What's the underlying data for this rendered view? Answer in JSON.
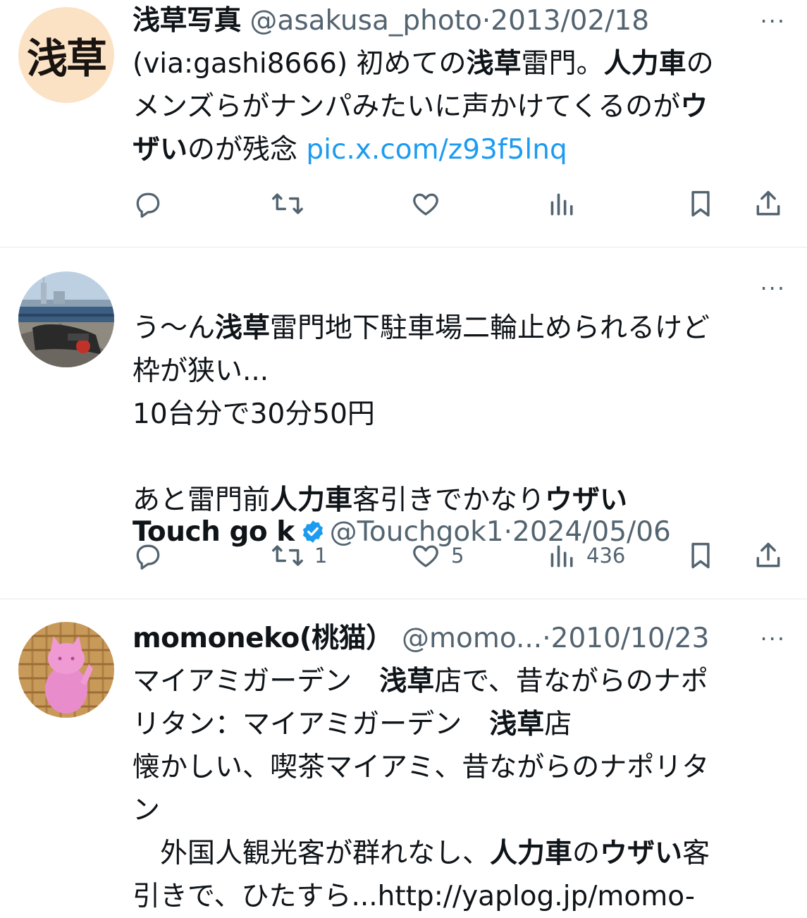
{
  "tweets": [
    {
      "name": "浅草写真",
      "handle": "@asakusa_photo",
      "sep": "·",
      "date": "2013/02/18",
      "avatar_text": "浅草",
      "verified": false,
      "text": {
        "l1a": "(via:gashi8666) 初めての",
        "l1b": "浅草",
        "l1c": "雷門。",
        "l1d": "人力車",
        "l1e": "の",
        "l2a": "メンズらがナンパみたいに声かけてくるのが",
        "l2b": "ウ",
        "l3a": "ザい",
        "l3b": "のが残念 ",
        "link": "pic.x.com/z93f5lnq"
      },
      "stats": {
        "retweets": "",
        "likes": "",
        "views": ""
      }
    },
    {
      "name": "Touch go k",
      "handle": "@Touchgok1",
      "sep": "·",
      "date": "2024/05/06",
      "verified": true,
      "text": {
        "l1a": "う〜ん",
        "l1b": "浅草",
        "l1c": "雷門地下駐車場二輪止められるけど",
        "l2": "枠が狭い...",
        "l3": "10台分で30分50円",
        "l5a": "あと雷門前",
        "l5b": "人力車",
        "l5c": "客引きでかなり",
        "l5d": "ウザい"
      },
      "stats": {
        "retweets": "1",
        "likes": "5",
        "views": "436"
      }
    },
    {
      "name": "momoneko(桃猫）",
      "handle": "@momo...",
      "sep": "·",
      "date": "2010/10/23",
      "verified": false,
      "text": {
        "l1a": "マイアミガーデン　",
        "l1b": "浅草",
        "l1c": "店で、昔ながらのナポ",
        "l2a": "リタン：マイアミガーデン　",
        "l2b": "浅草",
        "l2c": "店",
        "l3": "懐かしい、喫茶マイアミ、昔ながらのナポリタ",
        "l4": "ン",
        "l5a": "　外国人観光客が群れなし、",
        "l5b": "人力車",
        "l5c": "の",
        "l5d": "ウザい",
        "l5e": "客",
        "l6": "引きで、ひたすら...http://yaplog.jp/momo-"
      }
    }
  ],
  "more_label": "···",
  "colors": {
    "link": "#1d9bf0",
    "secondary": "#536471",
    "verified": "#1d9bf0",
    "divider": "#e6e9ec"
  },
  "icons": [
    "reply-icon",
    "retweet-icon",
    "like-icon",
    "views-icon",
    "bookmark-icon",
    "share-icon",
    "verified-badge-icon",
    "more-icon"
  ]
}
